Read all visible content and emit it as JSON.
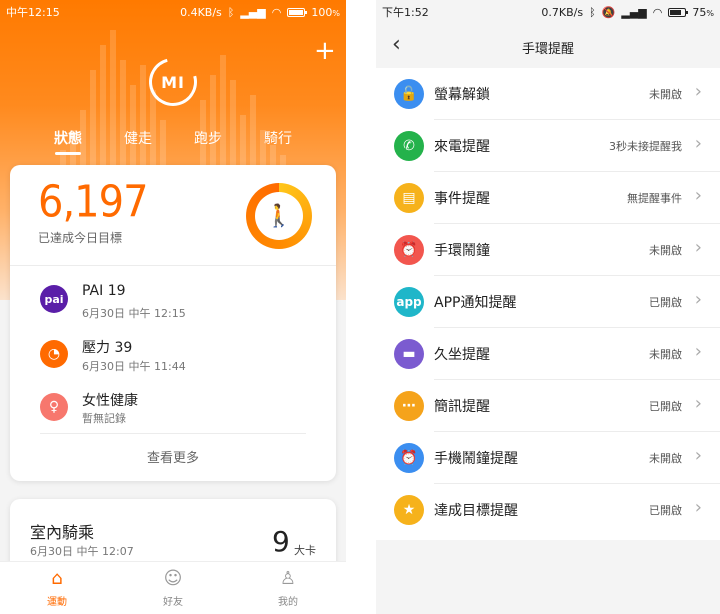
{
  "left": {
    "status": {
      "time": "中午12:15",
      "speed": "0.4KB/s",
      "battery": "100",
      "battery_unit": "%"
    },
    "logo": "MI",
    "tabs": [
      "狀態",
      "健走",
      "跑步",
      "騎行"
    ],
    "steps": {
      "value": "6,197",
      "subtitle": "已達成今日目標"
    },
    "rows": [
      {
        "icon": "pai",
        "title": "PAI 19",
        "subtitle": "6月30日 中午 12:15",
        "color": "#5a1ea8"
      },
      {
        "icon": "stress-gauge-icon",
        "title": "壓力 39",
        "subtitle": "6月30日 中午 11:44",
        "color": "#ff6a00"
      },
      {
        "icon": "female-icon",
        "title": "女性健康",
        "subtitle": "暫無記錄",
        "color": "#f7776d"
      }
    ],
    "more": "查看更多",
    "ride": {
      "title": "室內騎乘",
      "subtitle": "6月30日 中午 12:07",
      "value": "9",
      "unit": "大卡"
    },
    "nav": [
      {
        "label": "運動",
        "icon": "home-icon",
        "active": true
      },
      {
        "label": "好友",
        "icon": "friends-icon",
        "active": false
      },
      {
        "label": "我的",
        "icon": "profile-icon",
        "active": false
      }
    ],
    "accent": "#ff6a00"
  },
  "right": {
    "status": {
      "time": "下午1:52",
      "speed": "0.7KB/s",
      "battery": "75",
      "battery_unit": "%"
    },
    "title": "手環提醒",
    "items": [
      {
        "label": "螢幕解鎖",
        "value": "未開啟",
        "icon": "unlock-icon",
        "color": "#3b8ef0"
      },
      {
        "label": "來電提醒",
        "value": "3秒未接提醒我",
        "icon": "phone-icon",
        "color": "#24b24b"
      },
      {
        "label": "事件提醒",
        "value": "無提醒事件",
        "icon": "calendar-icon",
        "color": "#f6b21b"
      },
      {
        "label": "手環鬧鐘",
        "value": "未開啟",
        "icon": "alarm-icon",
        "color": "#f2564e"
      },
      {
        "label": "APP通知提醒",
        "value": "已開啟",
        "icon": "app-icon",
        "color": "#1fb6c9",
        "icon_text": "app"
      },
      {
        "label": "久坐提醒",
        "value": "未開啟",
        "icon": "sofa-icon",
        "color": "#7b5bd0"
      },
      {
        "label": "簡訊提醒",
        "value": "已開啟",
        "icon": "message-icon",
        "color": "#f5a31b"
      },
      {
        "label": "手機鬧鐘提醒",
        "value": "未開啟",
        "icon": "alarm-clock-icon",
        "color": "#3b8ef0"
      },
      {
        "label": "達成目標提醒",
        "value": "已開啟",
        "icon": "goal-badge-icon",
        "color": "#f6b21b"
      }
    ]
  }
}
